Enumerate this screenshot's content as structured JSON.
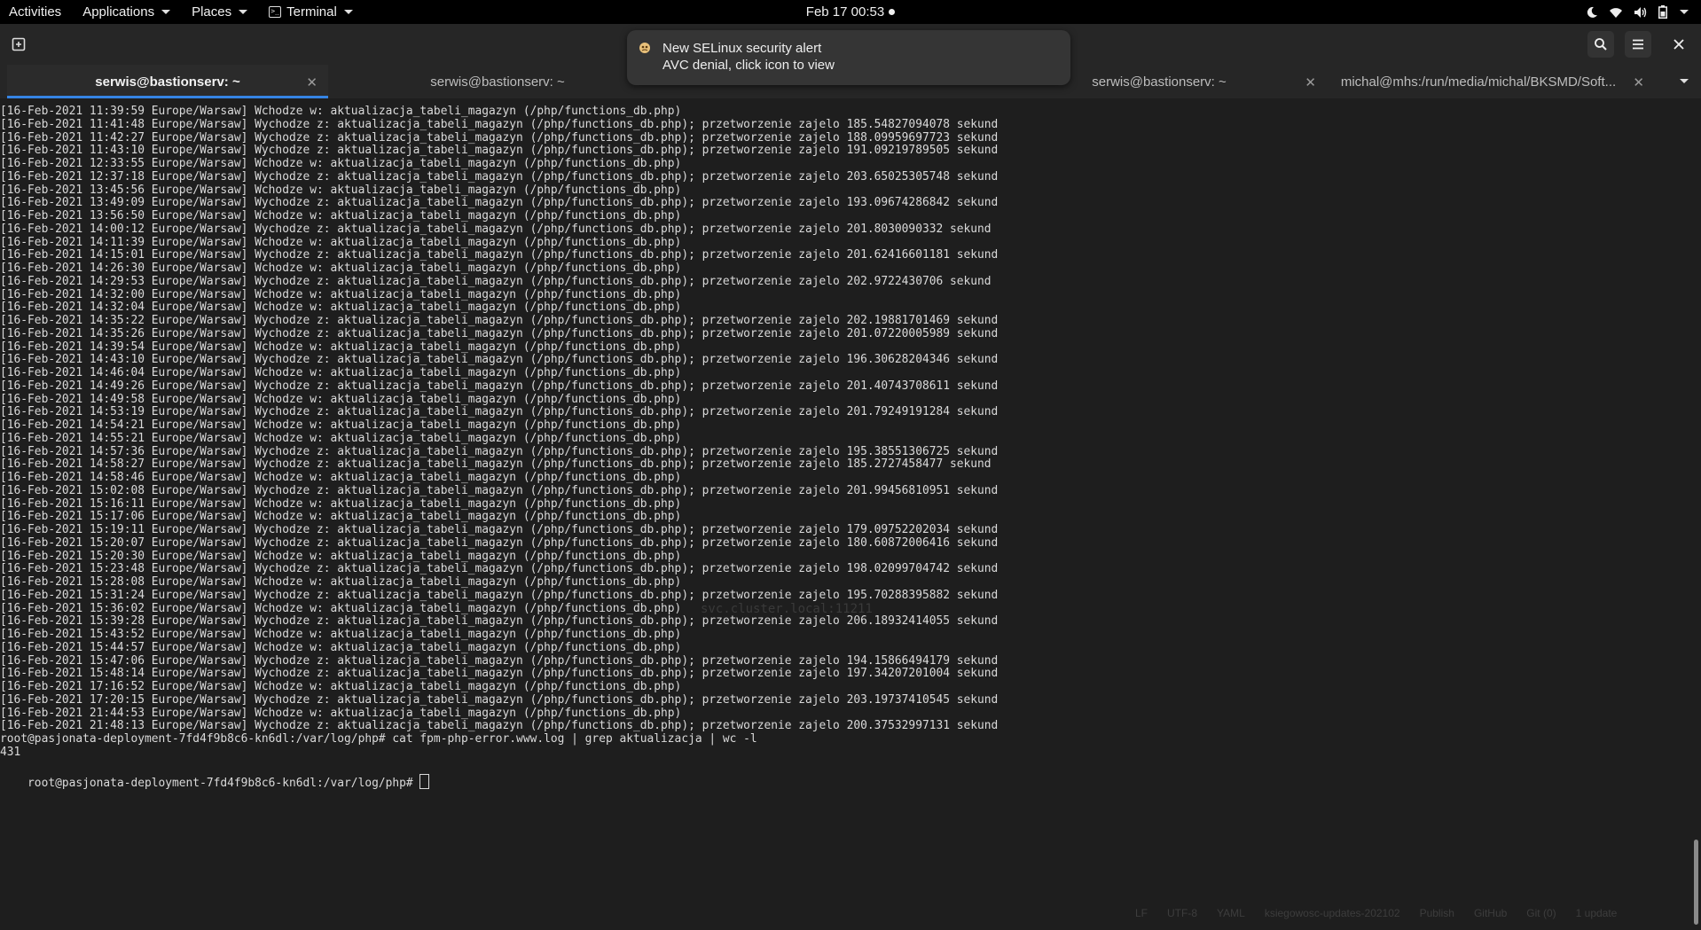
{
  "topbar": {
    "activities": "Activities",
    "applications": "Applications",
    "places": "Places",
    "terminal": "Terminal",
    "clock": "Feb 17  00:53"
  },
  "tabs": [
    {
      "label": "serwis@bastionserv: ~",
      "active": true
    },
    {
      "label": "serwis@bastionserv: ~",
      "active": false
    },
    {
      "label": "serwis@bastionserv: ~",
      "active": false
    },
    {
      "label": "michal@mhs:/run/media/michal/BKSMD/Soft...",
      "active": false
    }
  ],
  "notification": {
    "title": "New SELinux security alert",
    "body": "AVC denial, click icon to view"
  },
  "terminal": {
    "lines": [
      "[16-Feb-2021 11:39:59 Europe/Warsaw] Wchodze w: aktualizacja_tabeli_magazyn (/php/functions_db.php)",
      "[16-Feb-2021 11:41:48 Europe/Warsaw] Wychodze z: aktualizacja_tabeli_magazyn (/php/functions_db.php); przetworzenie zajelo 185.54827094078 sekund",
      "[16-Feb-2021 11:42:27 Europe/Warsaw] Wychodze z: aktualizacja_tabeli_magazyn (/php/functions_db.php); przetworzenie zajelo 188.09959697723 sekund",
      "[16-Feb-2021 11:43:10 Europe/Warsaw] Wychodze z: aktualizacja_tabeli_magazyn (/php/functions_db.php); przetworzenie zajelo 191.09219789505 sekund",
      "[16-Feb-2021 12:33:55 Europe/Warsaw] Wchodze w: aktualizacja_tabeli_magazyn (/php/functions_db.php)",
      "[16-Feb-2021 12:37:18 Europe/Warsaw] Wychodze z: aktualizacja_tabeli_magazyn (/php/functions_db.php); przetworzenie zajelo 203.65025305748 sekund",
      "[16-Feb-2021 13:45:56 Europe/Warsaw] Wchodze w: aktualizacja_tabeli_magazyn (/php/functions_db.php)",
      "[16-Feb-2021 13:49:09 Europe/Warsaw] Wychodze z: aktualizacja_tabeli_magazyn (/php/functions_db.php); przetworzenie zajelo 193.09674286842 sekund",
      "[16-Feb-2021 13:56:50 Europe/Warsaw] Wchodze w: aktualizacja_tabeli_magazyn (/php/functions_db.php)",
      "[16-Feb-2021 14:00:12 Europe/Warsaw] Wychodze z: aktualizacja_tabeli_magazyn (/php/functions_db.php); przetworzenie zajelo 201.8030090332 sekund",
      "[16-Feb-2021 14:11:39 Europe/Warsaw] Wchodze w: aktualizacja_tabeli_magazyn (/php/functions_db.php)",
      "[16-Feb-2021 14:15:01 Europe/Warsaw] Wychodze z: aktualizacja_tabeli_magazyn (/php/functions_db.php); przetworzenie zajelo 201.62416601181 sekund",
      "[16-Feb-2021 14:26:30 Europe/Warsaw] Wchodze w: aktualizacja_tabeli_magazyn (/php/functions_db.php)",
      "[16-Feb-2021 14:29:53 Europe/Warsaw] Wychodze z: aktualizacja_tabeli_magazyn (/php/functions_db.php); przetworzenie zajelo 202.9722430706 sekund",
      "[16-Feb-2021 14:32:00 Europe/Warsaw] Wchodze w: aktualizacja_tabeli_magazyn (/php/functions_db.php)",
      "[16-Feb-2021 14:32:04 Europe/Warsaw] Wchodze w: aktualizacja_tabeli_magazyn (/php/functions_db.php)",
      "[16-Feb-2021 14:35:22 Europe/Warsaw] Wychodze z: aktualizacja_tabeli_magazyn (/php/functions_db.php); przetworzenie zajelo 202.19881701469 sekund",
      "[16-Feb-2021 14:35:26 Europe/Warsaw] Wychodze z: aktualizacja_tabeli_magazyn (/php/functions_db.php); przetworzenie zajelo 201.07220005989 sekund",
      "[16-Feb-2021 14:39:54 Europe/Warsaw] Wchodze w: aktualizacja_tabeli_magazyn (/php/functions_db.php)",
      "[16-Feb-2021 14:43:10 Europe/Warsaw] Wychodze z: aktualizacja_tabeli_magazyn (/php/functions_db.php); przetworzenie zajelo 196.30628204346 sekund",
      "[16-Feb-2021 14:46:04 Europe/Warsaw] Wchodze w: aktualizacja_tabeli_magazyn (/php/functions_db.php)",
      "[16-Feb-2021 14:49:26 Europe/Warsaw] Wychodze z: aktualizacja_tabeli_magazyn (/php/functions_db.php); przetworzenie zajelo 201.40743708611 sekund",
      "[16-Feb-2021 14:49:58 Europe/Warsaw] Wchodze w: aktualizacja_tabeli_magazyn (/php/functions_db.php)",
      "[16-Feb-2021 14:53:19 Europe/Warsaw] Wychodze z: aktualizacja_tabeli_magazyn (/php/functions_db.php); przetworzenie zajelo 201.79249191284 sekund",
      "[16-Feb-2021 14:54:21 Europe/Warsaw] Wchodze w: aktualizacja_tabeli_magazyn (/php/functions_db.php)",
      "[16-Feb-2021 14:55:21 Europe/Warsaw] Wchodze w: aktualizacja_tabeli_magazyn (/php/functions_db.php)",
      "[16-Feb-2021 14:57:36 Europe/Warsaw] Wychodze z: aktualizacja_tabeli_magazyn (/php/functions_db.php); przetworzenie zajelo 195.38551306725 sekund",
      "[16-Feb-2021 14:58:27 Europe/Warsaw] Wychodze z: aktualizacja_tabeli_magazyn (/php/functions_db.php); przetworzenie zajelo 185.2727458477 sekund",
      "[16-Feb-2021 14:58:46 Europe/Warsaw] Wchodze w: aktualizacja_tabeli_magazyn (/php/functions_db.php)",
      "[16-Feb-2021 15:02:08 Europe/Warsaw] Wychodze z: aktualizacja_tabeli_magazyn (/php/functions_db.php); przetworzenie zajelo 201.99456810951 sekund",
      "[16-Feb-2021 15:16:11 Europe/Warsaw] Wchodze w: aktualizacja_tabeli_magazyn (/php/functions_db.php)",
      "[16-Feb-2021 15:17:06 Europe/Warsaw] Wchodze w: aktualizacja_tabeli_magazyn (/php/functions_db.php)",
      "[16-Feb-2021 15:19:11 Europe/Warsaw] Wychodze z: aktualizacja_tabeli_magazyn (/php/functions_db.php); przetworzenie zajelo 179.09752202034 sekund",
      "[16-Feb-2021 15:20:07 Europe/Warsaw] Wychodze z: aktualizacja_tabeli_magazyn (/php/functions_db.php); przetworzenie zajelo 180.60872006416 sekund",
      "[16-Feb-2021 15:20:30 Europe/Warsaw] Wchodze w: aktualizacja_tabeli_magazyn (/php/functions_db.php)",
      "[16-Feb-2021 15:23:48 Europe/Warsaw] Wychodze z: aktualizacja_tabeli_magazyn (/php/functions_db.php); przetworzenie zajelo 198.02099704742 sekund",
      "[16-Feb-2021 15:28:08 Europe/Warsaw] Wchodze w: aktualizacja_tabeli_magazyn (/php/functions_db.php)",
      "[16-Feb-2021 15:31:24 Europe/Warsaw] Wychodze z: aktualizacja_tabeli_magazyn (/php/functions_db.php); przetworzenie zajelo 195.70288395882 sekund",
      "[16-Feb-2021 15:36:02 Europe/Warsaw] Wchodze w: aktualizacja_tabeli_magazyn (/php/functions_db.php)",
      "[16-Feb-2021 15:39:28 Europe/Warsaw] Wychodze z: aktualizacja_tabeli_magazyn (/php/functions_db.php); przetworzenie zajelo 206.18932414055 sekund",
      "[16-Feb-2021 15:43:52 Europe/Warsaw] Wchodze w: aktualizacja_tabeli_magazyn (/php/functions_db.php)",
      "[16-Feb-2021 15:44:57 Europe/Warsaw] Wchodze w: aktualizacja_tabeli_magazyn (/php/functions_db.php)",
      "[16-Feb-2021 15:47:06 Europe/Warsaw] Wychodze z: aktualizacja_tabeli_magazyn (/php/functions_db.php); przetworzenie zajelo 194.15866494179 sekund",
      "[16-Feb-2021 15:48:14 Europe/Warsaw] Wychodze z: aktualizacja_tabeli_magazyn (/php/functions_db.php); przetworzenie zajelo 197.34207201004 sekund",
      "[16-Feb-2021 17:16:52 Europe/Warsaw] Wchodze w: aktualizacja_tabeli_magazyn (/php/functions_db.php)",
      "[16-Feb-2021 17:20:15 Europe/Warsaw] Wychodze z: aktualizacja_tabeli_magazyn (/php/functions_db.php); przetworzenie zajelo 203.19737410545 sekund",
      "[16-Feb-2021 21:44:53 Europe/Warsaw] Wchodze w: aktualizacja_tabeli_magazyn (/php/functions_db.php)",
      "[16-Feb-2021 21:48:13 Europe/Warsaw] Wychodze z: aktualizacja_tabeli_magazyn (/php/functions_db.php); przetworzenie zajelo 200.37532997131 sekund",
      "root@pasjonata-deployment-7fd4f9b8c6-kn6dl:/var/log/php# cat fpm-php-error.www.log | grep aktualizacja | wc -l",
      "431"
    ],
    "prompt": "root@pasjonata-deployment-7fd4f9b8c6-kn6dl:/var/log/php# ",
    "ghost_text": "svc.cluster.local:11211"
  },
  "status_ghost": [
    "LF",
    "UTF-8",
    "YAML",
    "ksiegowosc-updates-202102",
    "Publish",
    "GitHub",
    "Git (0)",
    "1 update"
  ],
  "icons": [
    "new-tab-icon",
    "search-icon",
    "hamburger-menu-icon",
    "close-icon",
    "night-light-icon",
    "wifi-icon",
    "volume-icon",
    "battery-icon",
    "selinux-alert-icon",
    "tab-close-icon",
    "tabs-dropdown-icon",
    "terminal-icon"
  ]
}
